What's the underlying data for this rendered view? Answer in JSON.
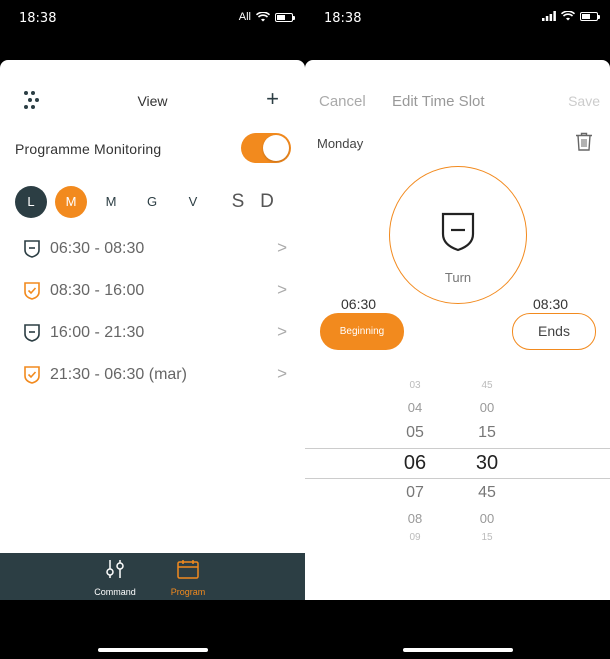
{
  "left": {
    "status": {
      "time": "18:38",
      "carrier": "All"
    },
    "header": {
      "title": "View",
      "add_label": "+"
    },
    "monitoring": {
      "label": "Programme Monitoring",
      "enabled": true
    },
    "days": [
      "L",
      "M",
      "M",
      "G",
      "V",
      "S",
      "D"
    ],
    "slots": [
      {
        "time": "06:30 - 08:30",
        "icon": "shield-minus-icon",
        "color": "#2c3e44"
      },
      {
        "time": "08:30 - 16:00",
        "icon": "shield-check-icon",
        "color": "#f28a1e"
      },
      {
        "time": "16:00 - 21:30",
        "icon": "shield-minus-icon",
        "color": "#2c3e44"
      },
      {
        "time": "21:30 - 06:30 (mar)",
        "icon": "shield-check-icon",
        "color": "#f28a1e"
      }
    ],
    "tabs": {
      "command": "Command",
      "program": "Program"
    }
  },
  "right": {
    "status": {
      "time": "18:38"
    },
    "header": {
      "cancel": "Cancel",
      "title": "Edit Time Slot",
      "save": "Save"
    },
    "day": "Monday",
    "mode_label": "Turn",
    "begin_time": "06:30",
    "end_time": "08:30",
    "begin_label": "Beginning",
    "end_label": "Ends",
    "picker": {
      "hours": [
        "03",
        "04",
        "05",
        "06",
        "07",
        "08",
        "09"
      ],
      "minutes": [
        "45",
        "00",
        "15",
        "30",
        "45",
        "00",
        "15"
      ]
    }
  },
  "colors": {
    "accent": "#f28a1e",
    "dark": "#2c3e44"
  }
}
